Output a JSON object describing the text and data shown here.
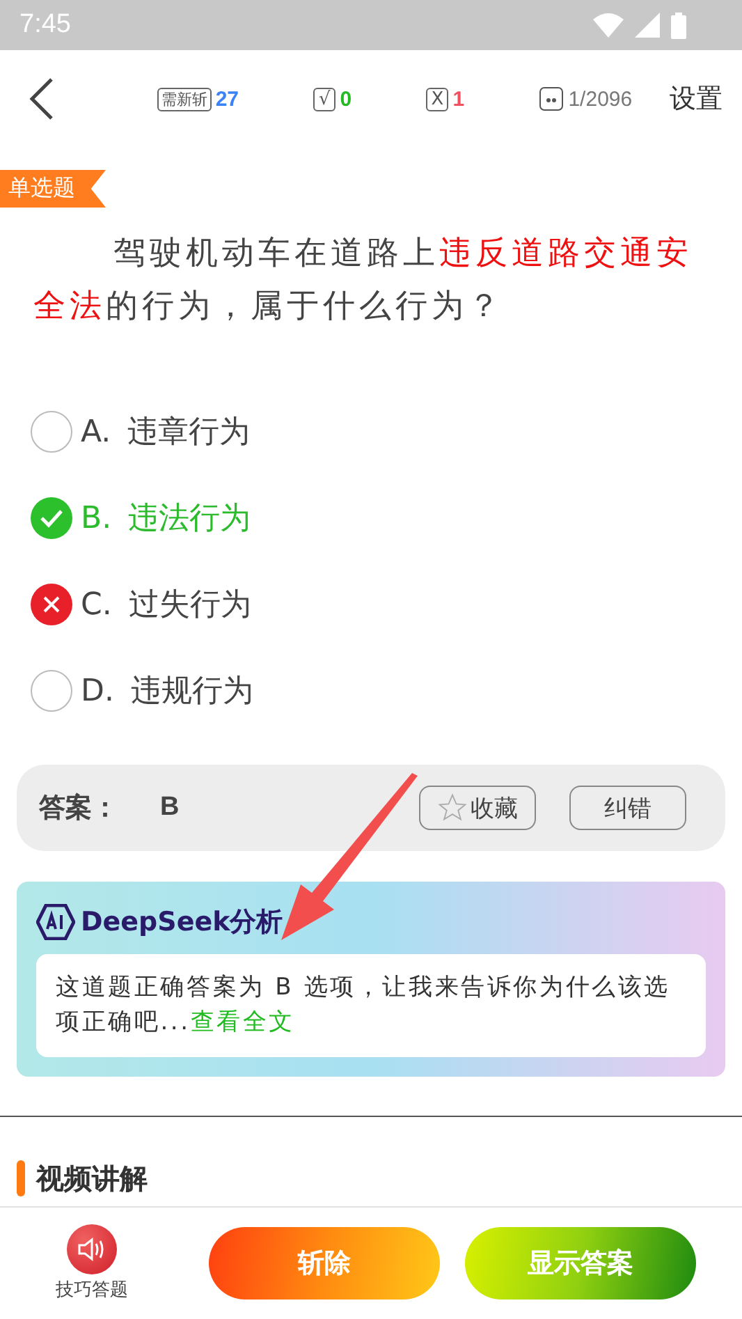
{
  "status_bar": {
    "time": "7:45"
  },
  "nav": {
    "stats": [
      {
        "kind": "renew",
        "badge": "需新斩",
        "value": "27",
        "color": "#3b82f6"
      },
      {
        "kind": "right",
        "badge": "√",
        "value": "0",
        "color": "#22bb22"
      },
      {
        "kind": "wrong",
        "badge": "X",
        "value": "1",
        "color": "#f05060"
      },
      {
        "kind": "progress",
        "value": "1/2096",
        "color": "#777777"
      }
    ],
    "settings": "设置"
  },
  "question": {
    "tag": "单选题",
    "segments": [
      {
        "text": "驾驶机动车在道路上",
        "highlighted": false
      },
      {
        "text": "违反道路交通安全法",
        "highlighted": true
      },
      {
        "text": "的行为，属于什么行为？",
        "highlighted": false
      }
    ]
  },
  "options": [
    {
      "letter": "A.",
      "text": "违章行为",
      "kind": "plain"
    },
    {
      "letter": "B.",
      "text": "违法行为",
      "kind": "correct"
    },
    {
      "letter": "C.",
      "text": "过失行为",
      "kind": "wrong"
    },
    {
      "letter": "D.",
      "text": "违规行为",
      "kind": "plain"
    }
  ],
  "answer": {
    "label": "答案：",
    "value": "B",
    "favorite": "收藏",
    "favorited": false,
    "report": "纠错"
  },
  "ai": {
    "title": "DeepSeek分析",
    "text": "这道题正确答案为 B 选项，让我来告诉你为什么该选项正确吧...",
    "link": "查看全文"
  },
  "video": {
    "title": "视频讲解"
  },
  "footer": {
    "tip": "技巧答题",
    "buttons": [
      {
        "kind": "remove",
        "label": "斩除"
      },
      {
        "kind": "show",
        "label": "显示答案"
      }
    ]
  }
}
